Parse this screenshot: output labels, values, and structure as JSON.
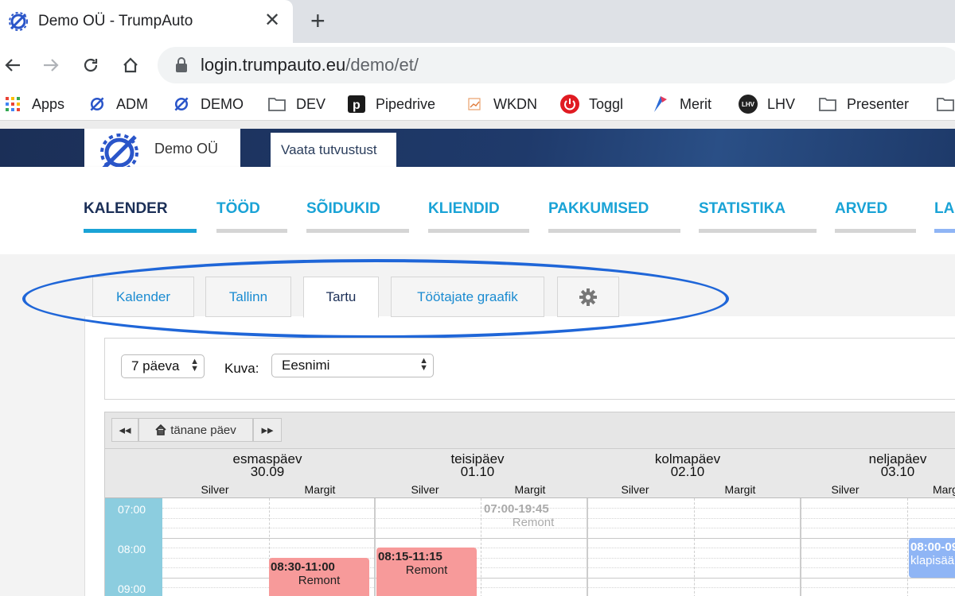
{
  "browser": {
    "tab_title": "Demo OÜ - TrumpAuto",
    "url_host": "login.trumpauto.eu",
    "url_path": "/demo/et/",
    "bookmarks": [
      "Apps",
      "ADM",
      "DEMO",
      "DEV",
      "Pipedrive",
      "WKDN",
      "Toggl",
      "Merit",
      "LHV",
      "Presenter"
    ]
  },
  "app": {
    "company": "Demo OÜ",
    "demo_tab": "Vaata tutvustust",
    "nav": [
      "KALENDER",
      "TÖÖD",
      "SÕIDUKID",
      "KLIENDID",
      "PAKKUMISED",
      "STATISTIKA",
      "ARVED",
      "LA"
    ],
    "active_nav": "KALENDER"
  },
  "subtabs": [
    "Kalender",
    "Tallinn",
    "Tartu",
    "Töötajate graafik"
  ],
  "active_subtab": "Tartu",
  "filters": {
    "range": "7 päeva",
    "kuva_label": "Kuva:",
    "kuva_value": "Eesnimi"
  },
  "calendar": {
    "today_button": "tänane päev",
    "prev": "◂◂",
    "next": "▸▸",
    "days": [
      {
        "name": "esmaspäev",
        "date": "30.09"
      },
      {
        "name": "teisipäev",
        "date": "01.10"
      },
      {
        "name": "kolmapäev",
        "date": "02.10"
      },
      {
        "name": "neljapäev",
        "date": "03.10"
      }
    ],
    "people": [
      "Silver",
      "Margit",
      "Silver",
      "Margit",
      "Silver",
      "Margit",
      "Silver",
      "Marg"
    ],
    "times": [
      "07:00",
      "08:00",
      "09:00"
    ],
    "events": [
      {
        "time": "07:00-19:45",
        "label": "Remont"
      },
      {
        "time": "08:15-11:15",
        "label": "Remont"
      },
      {
        "time": "08:30-11:00",
        "label": "Remont"
      },
      {
        "time": "08:00-09",
        "label": "klapisää"
      }
    ]
  },
  "colors": {
    "accent": "#1aa3d6",
    "navy": "#1b2f57",
    "event_red": "#f79a9a",
    "event_blue": "#8fb5f5",
    "time_col": "#8ccddf",
    "highlight_ellipse": "#1f66d8"
  }
}
